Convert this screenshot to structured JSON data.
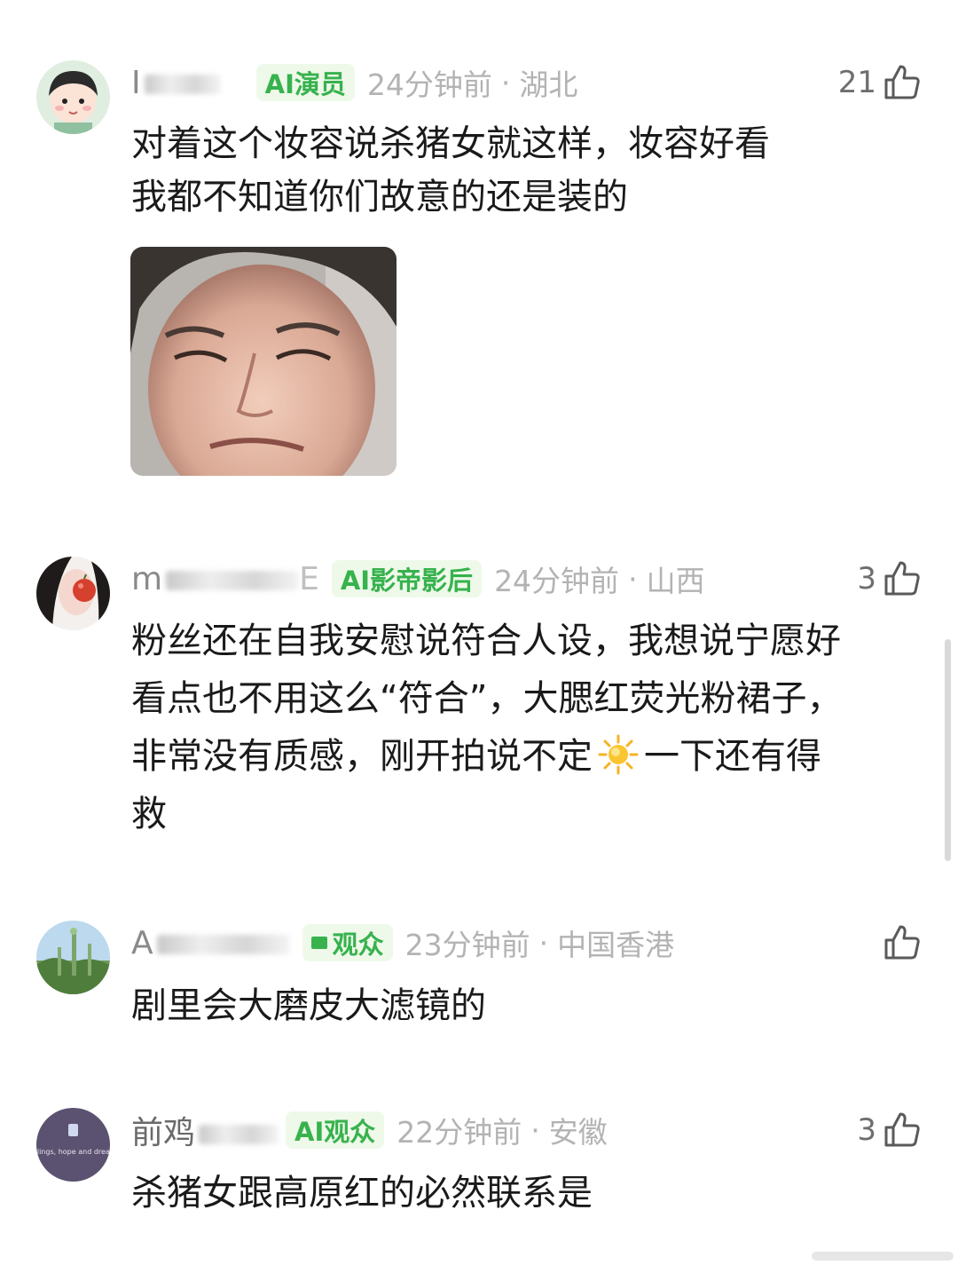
{
  "comments": [
    {
      "username": "I",
      "badge": "AI演员",
      "time": "24分钟前",
      "location": "湖北",
      "likes": "21",
      "lines": [
        "对着这个妆容说杀猪女就这样，妆容好看",
        "我都不知道你们故意的还是装的"
      ],
      "has_meme": true
    },
    {
      "username": "m",
      "username_tail": "E",
      "badge": "AI影帝影后",
      "time": "24分钟前",
      "location": "山西",
      "likes": "3",
      "line1": "粉丝还在自我安慰说符合人设，我想说宁愿好",
      "line2": "看点也不用这么“符合”，大腮红荧光粉裙子，",
      "line3a": "非常没有质感，刚开拍说不定",
      "line3b": "一下还有得",
      "line4": "救"
    },
    {
      "username": "A",
      "badge": "观众",
      "time": "23分钟前",
      "location": "中国香港",
      "likes": "",
      "lines": [
        "剧里会大磨皮大滤镜的"
      ]
    },
    {
      "username": "前鸡",
      "badge": "AI观众",
      "time": "22分钟前",
      "location": "安徽",
      "likes": "3",
      "avatar_text": "feelings, hope and dreams",
      "lines": [
        "杀猪女跟高原红的必然联系是"
      ]
    }
  ],
  "separator": "·",
  "icons": {
    "like": "thumbs-up-icon",
    "sun": "sun-emoji-icon"
  },
  "colors": {
    "badge_text": "#37b24d",
    "badge_bg": "#eef9ea",
    "meta_text": "#b3b3b3",
    "body_text": "#1a1a1a"
  }
}
